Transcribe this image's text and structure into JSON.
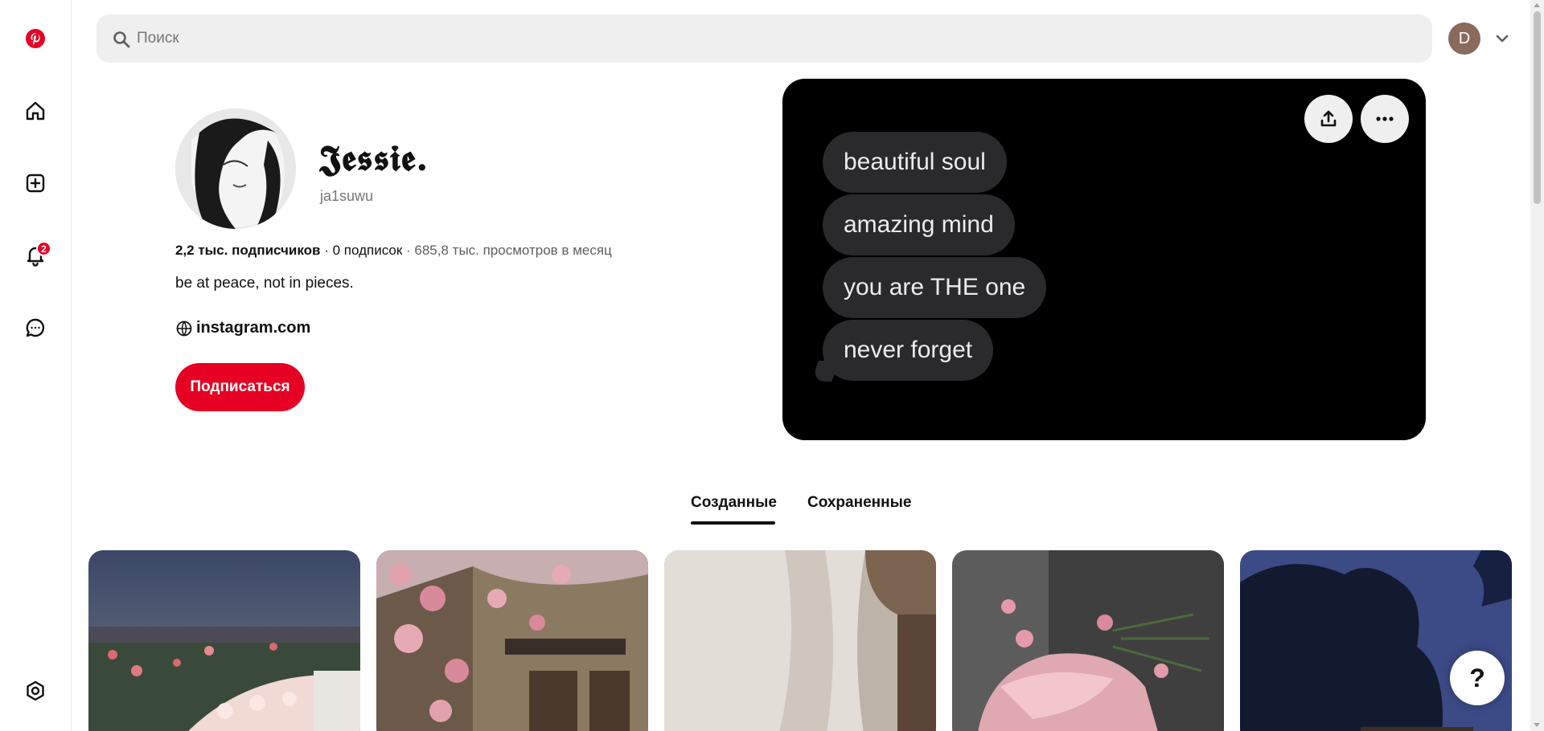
{
  "search": {
    "placeholder": "Поиск"
  },
  "user_menu": {
    "initial": "D"
  },
  "nav": {
    "notifications_count": "2"
  },
  "profile": {
    "name": "𝕵𝖊𝖘𝖘𝖎𝖊.",
    "handle": "ja1suwu",
    "followers": "2,2 тыс. подписчиков",
    "separator1": " · ",
    "following": "0 подписок",
    "separator2": " · ",
    "views": "685,8 тыс. просмотров в месяц",
    "bio": "be at peace, not in pieces.",
    "website": "instagram.com",
    "follow_label": "Подписаться"
  },
  "cover": {
    "messages": [
      "beautiful soul",
      "amazing mind",
      "you are THE one",
      "never forget"
    ]
  },
  "tabs": [
    {
      "label": "Созданные",
      "active": true
    },
    {
      "label": "Сохраненные",
      "active": false
    }
  ],
  "help": {
    "label": "?"
  },
  "colors": {
    "brand": "#e60023",
    "cover_bg": "#000000",
    "bubble": "#2a2a2c"
  }
}
